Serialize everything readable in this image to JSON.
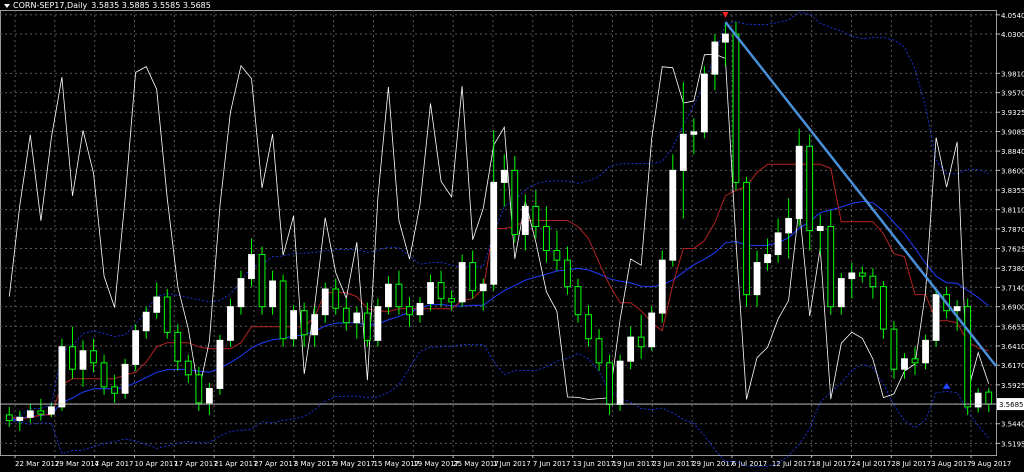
{
  "header": {
    "symbol": "CORN-SEP17,Daily",
    "ohlc": "3.5835 3.5885 3.5585 3.5685"
  },
  "colors": {
    "background": "#000000",
    "grid": "#5a5a5a",
    "bull_candle": "#ffffff",
    "bear_candle": "#000000",
    "wick": "#00ff00",
    "white_line": "#ffffff",
    "red_line": "#b22222",
    "blue_line": "#1e3cff",
    "trendline": "#4a90d9",
    "current_price_bg": "#ffffff"
  },
  "chart_data": {
    "type": "candlestick",
    "title": "CORN-SEP17,Daily",
    "symbol": "CORN-SEP17",
    "timeframe": "Daily",
    "last_ohlc": {
      "open": 3.5835,
      "high": 3.5885,
      "low": 3.5585,
      "close": 3.5685
    },
    "current_price_label": "3.5685",
    "y_range": [
      3.505,
      4.06
    ],
    "y_ticks": [
      "4.0540",
      "4.0300",
      "3.9810",
      "3.9570",
      "3.9325",
      "3.9085",
      "3.8840",
      "3.8600",
      "3.8355",
      "3.8110",
      "3.7870",
      "3.7625",
      "3.7380",
      "3.7140",
      "3.6900",
      "3.6655",
      "3.6410",
      "3.6170",
      "3.5925",
      "3.5685",
      "3.5440",
      "3.5195"
    ],
    "x_ticks": [
      "22 Mar 2017",
      "29 Mar 2017",
      "4 Apr 2017",
      "10 Apr 2017",
      "17 Apr 2017",
      "21 Apr 2017",
      "27 Apr 2017",
      "3 May 2017",
      "9 May 2017",
      "15 May 2017",
      "19 May 2017",
      "25 May 2017",
      "1 Jun 2017",
      "7 Jun 2017",
      "13 Jun 2017",
      "19 Jun 2017",
      "23 Jun 2017",
      "29 Jun 2017",
      "6 Jul 2017",
      "12 Jul 2017",
      "18 Jul 2017",
      "24 Jul 2017",
      "28 Jul 2017",
      "3 Aug 2017",
      "9 Aug 2017"
    ],
    "candles": [
      {
        "o": 3.555,
        "h": 3.565,
        "l": 3.54,
        "c": 3.548
      },
      {
        "o": 3.548,
        "h": 3.56,
        "l": 3.535,
        "c": 3.552
      },
      {
        "o": 3.552,
        "h": 3.568,
        "l": 3.545,
        "c": 3.56
      },
      {
        "o": 3.56,
        "h": 3.575,
        "l": 3.548,
        "c": 3.556
      },
      {
        "o": 3.556,
        "h": 3.57,
        "l": 3.552,
        "c": 3.565
      },
      {
        "o": 3.565,
        "h": 3.65,
        "l": 3.56,
        "c": 3.64
      },
      {
        "o": 3.64,
        "h": 3.665,
        "l": 3.6,
        "c": 3.612
      },
      {
        "o": 3.612,
        "h": 3.648,
        "l": 3.59,
        "c": 3.635
      },
      {
        "o": 3.635,
        "h": 3.65,
        "l": 3.608,
        "c": 3.62
      },
      {
        "o": 3.62,
        "h": 3.63,
        "l": 3.58,
        "c": 3.59
      },
      {
        "o": 3.59,
        "h": 3.605,
        "l": 3.57,
        "c": 3.582
      },
      {
        "o": 3.582,
        "h": 3.625,
        "l": 3.575,
        "c": 3.618
      },
      {
        "o": 3.618,
        "h": 3.668,
        "l": 3.61,
        "c": 3.66
      },
      {
        "o": 3.66,
        "h": 3.69,
        "l": 3.65,
        "c": 3.683
      },
      {
        "o": 3.683,
        "h": 3.72,
        "l": 3.675,
        "c": 3.702
      },
      {
        "o": 3.702,
        "h": 3.712,
        "l": 3.65,
        "c": 3.658
      },
      {
        "o": 3.658,
        "h": 3.668,
        "l": 3.61,
        "c": 3.622
      },
      {
        "o": 3.622,
        "h": 3.63,
        "l": 3.595,
        "c": 3.605
      },
      {
        "o": 3.605,
        "h": 3.615,
        "l": 3.56,
        "c": 3.57
      },
      {
        "o": 3.57,
        "h": 3.595,
        "l": 3.555,
        "c": 3.588
      },
      {
        "o": 3.588,
        "h": 3.655,
        "l": 3.58,
        "c": 3.648
      },
      {
        "o": 3.648,
        "h": 3.7,
        "l": 3.64,
        "c": 3.69
      },
      {
        "o": 3.69,
        "h": 3.735,
        "l": 3.68,
        "c": 3.725
      },
      {
        "o": 3.725,
        "h": 3.775,
        "l": 3.715,
        "c": 3.755
      },
      {
        "o": 3.755,
        "h": 3.765,
        "l": 3.68,
        "c": 3.69
      },
      {
        "o": 3.69,
        "h": 3.735,
        "l": 3.68,
        "c": 3.722
      },
      {
        "o": 3.722,
        "h": 3.73,
        "l": 3.64,
        "c": 3.65
      },
      {
        "o": 3.65,
        "h": 3.692,
        "l": 3.64,
        "c": 3.685
      },
      {
        "o": 3.685,
        "h": 3.695,
        "l": 3.64,
        "c": 3.655
      },
      {
        "o": 3.655,
        "h": 3.69,
        "l": 3.64,
        "c": 3.68
      },
      {
        "o": 3.68,
        "h": 3.72,
        "l": 3.67,
        "c": 3.712
      },
      {
        "o": 3.712,
        "h": 3.725,
        "l": 3.68,
        "c": 3.688
      },
      {
        "o": 3.688,
        "h": 3.7,
        "l": 3.66,
        "c": 3.67
      },
      {
        "o": 3.67,
        "h": 3.69,
        "l": 3.65,
        "c": 3.682
      },
      {
        "o": 3.682,
        "h": 3.695,
        "l": 3.64,
        "c": 3.648
      },
      {
        "o": 3.648,
        "h": 3.7,
        "l": 3.64,
        "c": 3.69
      },
      {
        "o": 3.69,
        "h": 3.728,
        "l": 3.68,
        "c": 3.718
      },
      {
        "o": 3.718,
        "h": 3.735,
        "l": 3.68,
        "c": 3.69
      },
      {
        "o": 3.69,
        "h": 3.702,
        "l": 3.665,
        "c": 3.68
      },
      {
        "o": 3.68,
        "h": 3.702,
        "l": 3.67,
        "c": 3.694
      },
      {
        "o": 3.694,
        "h": 3.73,
        "l": 3.685,
        "c": 3.72
      },
      {
        "o": 3.72,
        "h": 3.735,
        "l": 3.69,
        "c": 3.7
      },
      {
        "o": 3.7,
        "h": 3.71,
        "l": 3.685,
        "c": 3.696
      },
      {
        "o": 3.696,
        "h": 3.755,
        "l": 3.69,
        "c": 3.745
      },
      {
        "o": 3.745,
        "h": 3.76,
        "l": 3.7,
        "c": 3.71
      },
      {
        "o": 3.71,
        "h": 3.725,
        "l": 3.685,
        "c": 3.718
      },
      {
        "o": 3.718,
        "h": 3.91,
        "l": 3.71,
        "c": 3.845
      },
      {
        "o": 3.845,
        "h": 3.88,
        "l": 3.815,
        "c": 3.86
      },
      {
        "o": 3.86,
        "h": 3.878,
        "l": 3.77,
        "c": 3.78
      },
      {
        "o": 3.78,
        "h": 3.83,
        "l": 3.76,
        "c": 3.815
      },
      {
        "o": 3.815,
        "h": 3.835,
        "l": 3.775,
        "c": 3.79
      },
      {
        "o": 3.79,
        "h": 3.815,
        "l": 3.745,
        "c": 3.76
      },
      {
        "o": 3.76,
        "h": 3.785,
        "l": 3.735,
        "c": 3.748
      },
      {
        "o": 3.748,
        "h": 3.765,
        "l": 3.705,
        "c": 3.715
      },
      {
        "o": 3.715,
        "h": 3.725,
        "l": 3.67,
        "c": 3.68
      },
      {
        "o": 3.68,
        "h": 3.692,
        "l": 3.64,
        "c": 3.65
      },
      {
        "o": 3.65,
        "h": 3.662,
        "l": 3.61,
        "c": 3.62
      },
      {
        "o": 3.62,
        "h": 3.63,
        "l": 3.555,
        "c": 3.568
      },
      {
        "o": 3.568,
        "h": 3.63,
        "l": 3.56,
        "c": 3.622
      },
      {
        "o": 3.622,
        "h": 3.665,
        "l": 3.612,
        "c": 3.652
      },
      {
        "o": 3.652,
        "h": 3.68,
        "l": 3.625,
        "c": 3.64
      },
      {
        "o": 3.64,
        "h": 3.69,
        "l": 3.635,
        "c": 3.682
      },
      {
        "o": 3.682,
        "h": 3.76,
        "l": 3.67,
        "c": 3.748
      },
      {
        "o": 3.748,
        "h": 3.88,
        "l": 3.74,
        "c": 3.86
      },
      {
        "o": 3.86,
        "h": 3.97,
        "l": 3.8,
        "c": 3.905
      },
      {
        "o": 3.905,
        "h": 3.925,
        "l": 3.88,
        "c": 3.908
      },
      {
        "o": 3.908,
        "h": 3.99,
        "l": 3.9,
        "c": 3.98
      },
      {
        "o": 3.98,
        "h": 4.03,
        "l": 3.96,
        "c": 4.02
      },
      {
        "o": 4.02,
        "h": 4.045,
        "l": 3.99,
        "c": 4.03
      },
      {
        "o": 4.03,
        "h": 4.045,
        "l": 3.835,
        "c": 3.845
      },
      {
        "o": 3.845,
        "h": 3.852,
        "l": 3.69,
        "c": 3.705
      },
      {
        "o": 3.705,
        "h": 3.76,
        "l": 3.69,
        "c": 3.745
      },
      {
        "o": 3.745,
        "h": 3.775,
        "l": 3.735,
        "c": 3.755
      },
      {
        "o": 3.755,
        "h": 3.8,
        "l": 3.745,
        "c": 3.782
      },
      {
        "o": 3.782,
        "h": 3.825,
        "l": 3.75,
        "c": 3.8
      },
      {
        "o": 3.8,
        "h": 3.912,
        "l": 3.79,
        "c": 3.89
      },
      {
        "o": 3.89,
        "h": 3.905,
        "l": 3.76,
        "c": 3.785
      },
      {
        "o": 3.785,
        "h": 3.805,
        "l": 3.755,
        "c": 3.79
      },
      {
        "o": 3.79,
        "h": 3.81,
        "l": 3.68,
        "c": 3.69
      },
      {
        "o": 3.69,
        "h": 3.732,
        "l": 3.68,
        "c": 3.725
      },
      {
        "o": 3.725,
        "h": 3.745,
        "l": 3.7,
        "c": 3.732
      },
      {
        "o": 3.732,
        "h": 3.74,
        "l": 3.72,
        "c": 3.728
      },
      {
        "o": 3.728,
        "h": 3.738,
        "l": 3.7,
        "c": 3.715
      },
      {
        "o": 3.715,
        "h": 3.722,
        "l": 3.65,
        "c": 3.662
      },
      {
        "o": 3.662,
        "h": 3.672,
        "l": 3.6,
        "c": 3.612
      },
      {
        "o": 3.612,
        "h": 3.632,
        "l": 3.6,
        "c": 3.625
      },
      {
        "o": 3.625,
        "h": 3.64,
        "l": 3.605,
        "c": 3.62
      },
      {
        "o": 3.62,
        "h": 3.655,
        "l": 3.612,
        "c": 3.648
      },
      {
        "o": 3.648,
        "h": 3.712,
        "l": 3.64,
        "c": 3.705
      },
      {
        "o": 3.705,
        "h": 3.715,
        "l": 3.675,
        "c": 3.685
      },
      {
        "o": 3.685,
        "h": 3.698,
        "l": 3.66,
        "c": 3.69
      },
      {
        "o": 3.69,
        "h": 3.7,
        "l": 3.555,
        "c": 3.565
      },
      {
        "o": 3.565,
        "h": 3.588,
        "l": 3.558,
        "c": 3.582
      },
      {
        "o": 3.5835,
        "h": 3.5885,
        "l": 3.5585,
        "c": 3.5685
      }
    ]
  }
}
